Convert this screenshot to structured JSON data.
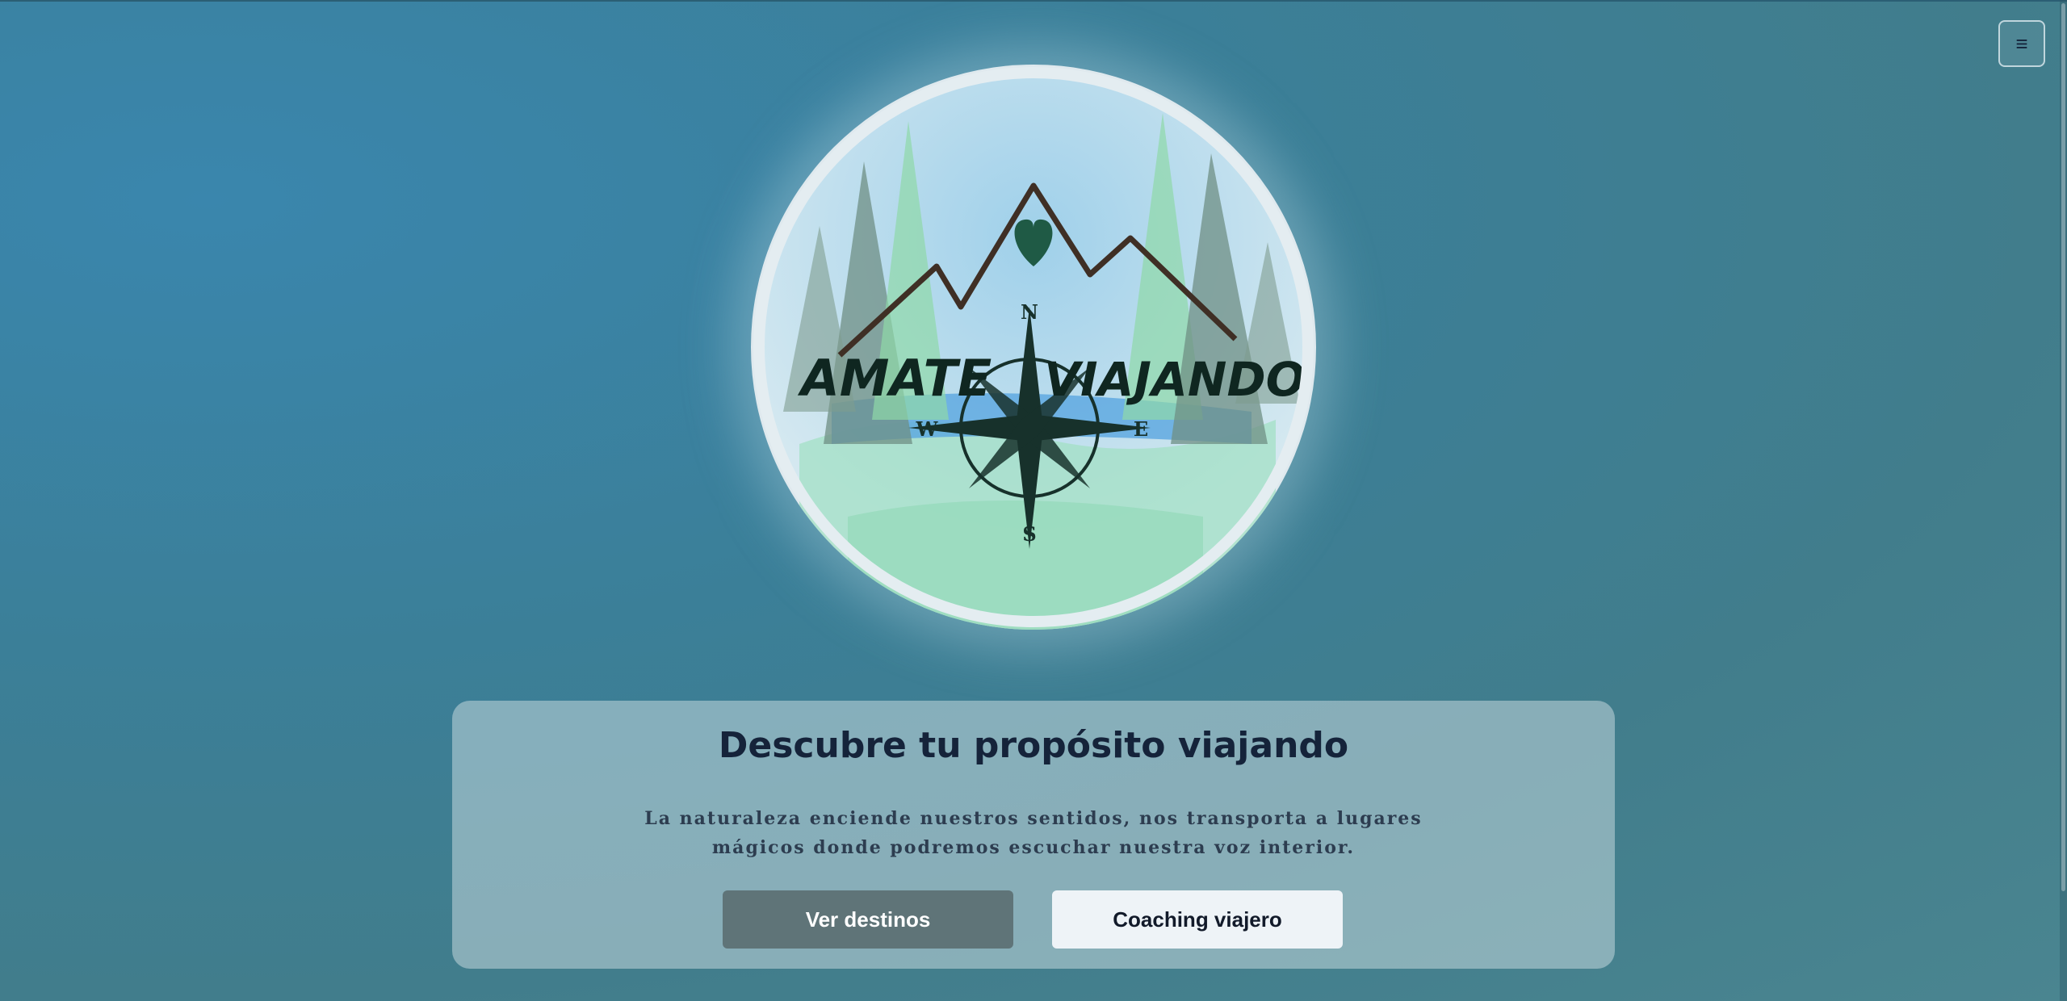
{
  "header": {
    "menu_icon": "hamburger-menu-icon",
    "menu_glyph": "≡"
  },
  "logo": {
    "title_left": "AMATE",
    "title_right": "VIAJANDO",
    "compass": {
      "n": "N",
      "s": "S",
      "e": "E",
      "w": "W"
    }
  },
  "hero": {
    "headline": "Descubre tu propósito viajando",
    "subtext": "La naturaleza enciende nuestros sentidos, nos transporta a lugares mágicos donde podremos escuchar nuestra voz interior.",
    "primary_button": "Ver destinos",
    "secondary_button": "Coaching viajero"
  },
  "colors": {
    "background": "#3b7f98",
    "panel": "#c3d7dc",
    "primary_button": "#5f7478",
    "secondary_button": "#eef3f7",
    "headline": "#15233a"
  }
}
